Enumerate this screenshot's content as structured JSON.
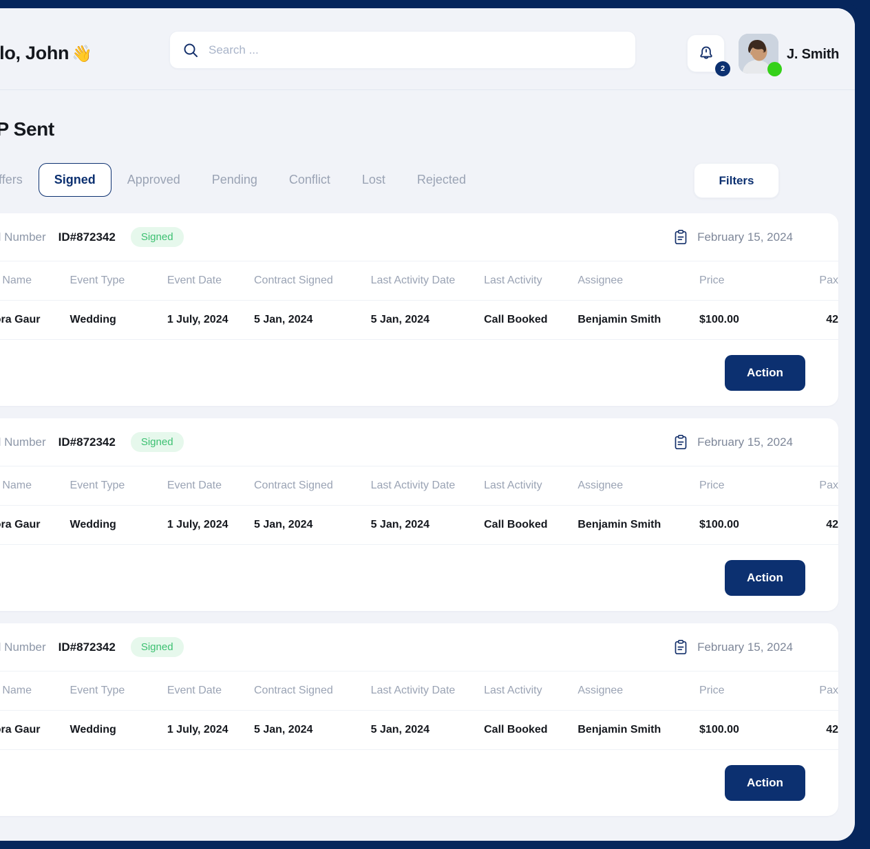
{
  "header": {
    "greeting": "Hello, John",
    "wave_emoji": "👋",
    "search_placeholder": "Search ...",
    "search_value": "",
    "notification_count": "2",
    "username": "J. Smith"
  },
  "page": {
    "title": "RFP Sent",
    "filters_label": "Filters"
  },
  "tabs": [
    {
      "label": "All offers",
      "active": false
    },
    {
      "label": "Signed",
      "active": true
    },
    {
      "label": "Approved",
      "active": false
    },
    {
      "label": "Pending",
      "active": false
    },
    {
      "label": "Conflict",
      "active": false
    },
    {
      "label": "Lost",
      "active": false
    },
    {
      "label": "Rejected",
      "active": false
    }
  ],
  "table": {
    "columns": [
      "Client Name",
      "Event Type",
      "Event Date",
      "Contract Signed",
      "Last Activity Date",
      "Last Activity",
      "Assignee",
      "Price",
      "Pax"
    ]
  },
  "cards": [
    {
      "serial_label": "Serial Number",
      "serial_id": "ID#872342",
      "status": "Signed",
      "date": "February 15, 2024",
      "action_label": "Action",
      "row": {
        "client_name": "Aurrora Gaur",
        "event_type": "Wedding",
        "event_date": "1 July, 2024",
        "contract_signed": "5 Jan, 2024",
        "last_activity_date": "5 Jan, 2024",
        "last_activity": "Call Booked",
        "assignee": "Benjamin Smith",
        "price": "$100.00",
        "pax": "42"
      }
    },
    {
      "serial_label": "Serial Number",
      "serial_id": "ID#872342",
      "status": "Signed",
      "date": "February 15, 2024",
      "action_label": "Action",
      "row": {
        "client_name": "Aurrora Gaur",
        "event_type": "Wedding",
        "event_date": "1 July, 2024",
        "contract_signed": "5 Jan, 2024",
        "last_activity_date": "5 Jan, 2024",
        "last_activity": "Call Booked",
        "assignee": "Benjamin Smith",
        "price": "$100.00",
        "pax": "42"
      }
    },
    {
      "serial_label": "Serial Number",
      "serial_id": "ID#872342",
      "status": "Signed",
      "date": "February 15, 2024",
      "action_label": "Action",
      "row": {
        "client_name": "Aurrora Gaur",
        "event_type": "Wedding",
        "event_date": "1 July, 2024",
        "contract_signed": "5 Jan, 2024",
        "last_activity_date": "5 Jan, 2024",
        "last_activity": "Call Booked",
        "assignee": "Benjamin Smith",
        "price": "$100.00",
        "pax": "42"
      }
    }
  ],
  "colors": {
    "frame_navy": "#06265c",
    "brand_navy": "#0c3070",
    "page_bg": "#f1f3f8",
    "card_bg": "#ffffff",
    "status_green_text": "#3cc071",
    "status_green_bg": "#e6f8ec",
    "online_dot": "#35d119",
    "muted_text": "#9aa3b4"
  }
}
